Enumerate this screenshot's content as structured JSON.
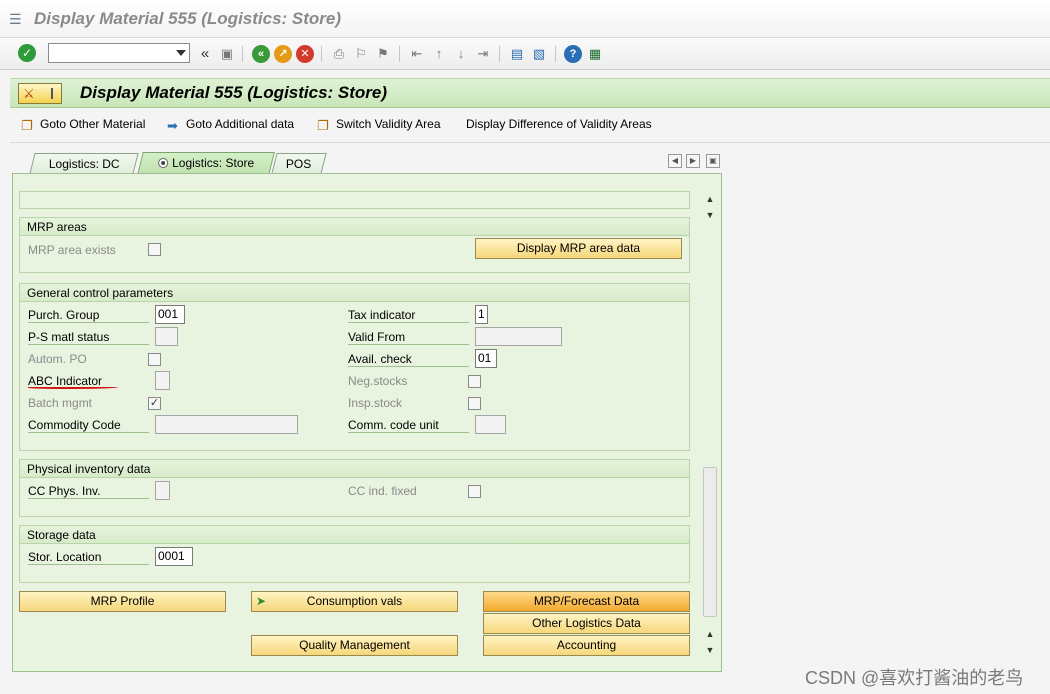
{
  "window": {
    "title": "Display Material 555 (Logistics: Store)"
  },
  "toolbar": {
    "command_value": "",
    "icons": [
      "enter-icon",
      "back-arrows-icon",
      "save-icon",
      "back-icon",
      "exit-icon",
      "cancel-icon",
      "print-icon",
      "find-icon",
      "find-next-icon",
      "first-page-icon",
      "prev-page-icon",
      "next-page-icon",
      "last-page-icon",
      "create-session-icon",
      "shortcut-icon",
      "help-icon",
      "layout-icon"
    ],
    "more": "«"
  },
  "header": {
    "title": "Display Material 555 (Logistics: Store)"
  },
  "app_toolbar": {
    "goto_other_material": "Goto Other Material",
    "goto_additional_data": "Goto Additional data",
    "switch_validity_area": "Switch Validity Area",
    "display_difference": "Display Difference of Validity Areas"
  },
  "tabs": [
    {
      "label": "Logistics: DC"
    },
    {
      "label": "Logistics: Store",
      "active": true
    },
    {
      "label": "POS"
    }
  ],
  "mrp_areas": {
    "title": "MRP areas",
    "mrp_area_exists": "MRP area exists",
    "display_button": "Display MRP area data"
  },
  "general": {
    "title": "General control parameters",
    "purch_group": {
      "label": "Purch. Group",
      "value": "001"
    },
    "ps_matl_status": {
      "label": "P-S matl status",
      "value": ""
    },
    "autom_po": {
      "label": "Autom. PO",
      "checked": false
    },
    "abc_indicator": {
      "label": "ABC Indicator",
      "value": ""
    },
    "batch_mgmt": {
      "label": "Batch mgmt",
      "checked": true
    },
    "commodity_code": {
      "label": "Commodity Code",
      "value": ""
    },
    "tax_indicator": {
      "label": "Tax indicator",
      "value": "1"
    },
    "valid_from": {
      "label": "Valid From",
      "value": ""
    },
    "avail_check": {
      "label": "Avail. check",
      "value": "01"
    },
    "neg_stocks": {
      "label": "Neg.stocks",
      "checked": false
    },
    "insp_stock": {
      "label": "Insp.stock",
      "checked": false
    },
    "comm_code_unit": {
      "label": "Comm. code unit",
      "value": ""
    }
  },
  "physical": {
    "title": "Physical inventory data",
    "cc_phys_inv": {
      "label": "CC Phys. Inv.",
      "value": ""
    },
    "cc_ind_fixed": {
      "label": "CC ind. fixed",
      "checked": false
    }
  },
  "storage": {
    "title": "Storage data",
    "stor_location": {
      "label": "Stor. Location",
      "value": "0001"
    }
  },
  "bottom_buttons": {
    "mrp_profile": "MRP Profile",
    "consumption_vals": "Consumption vals",
    "mrp_forecast": "MRP/Forecast Data",
    "other_logistics": "Other Logistics Data",
    "quality_management": "Quality Management",
    "accounting": "Accounting"
  },
  "watermark": "CSDN @喜欢打酱油的老鸟",
  "colors": {
    "header_green": "#c8e6b8",
    "panel_green": "#e8f4df",
    "button_yellow": "#f6d77a",
    "button_orange": "#f2a92e",
    "annotation_red": "#d21414"
  }
}
